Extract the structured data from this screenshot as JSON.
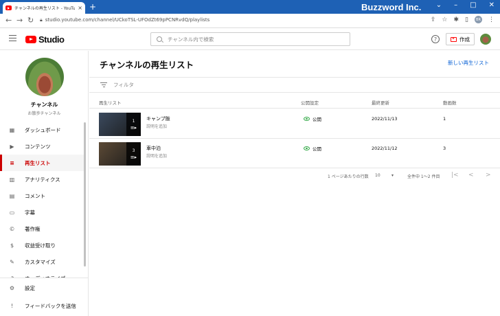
{
  "browser": {
    "tab_title": "チャンネルの再生リスト - YouTube Stu",
    "url": "studio.youtube.com/channel/UCkoTSL-UFOdZt69pPCNRvdQ/playlists",
    "brand": "Buzzword Inc.",
    "profile_initials": "BR"
  },
  "header": {
    "logo_text": "Studio",
    "search_placeholder": "チャンネル内で検索",
    "create_label": "作成"
  },
  "channel": {
    "name": "チャンネル",
    "subtitle": "お散歩チャンネル"
  },
  "sidebar": {
    "items": [
      {
        "label": "ダッシュボード",
        "icon": "dashboard-icon"
      },
      {
        "label": "コンテンツ",
        "icon": "content-icon"
      },
      {
        "label": "再生リスト",
        "icon": "playlist-icon",
        "active": true
      },
      {
        "label": "アナリティクス",
        "icon": "analytics-icon"
      },
      {
        "label": "コメント",
        "icon": "comment-icon"
      },
      {
        "label": "字幕",
        "icon": "subtitles-icon"
      },
      {
        "label": "著作権",
        "icon": "copyright-icon"
      },
      {
        "label": "収益受け取り",
        "icon": "monetization-icon"
      },
      {
        "label": "カスタマイズ",
        "icon": "customize-icon"
      },
      {
        "label": "オーディオライブ",
        "icon": "audio-library-icon"
      }
    ],
    "bottom": [
      {
        "label": "設定",
        "icon": "settings-icon"
      },
      {
        "label": "フィードバックを送信",
        "icon": "feedback-icon"
      }
    ]
  },
  "main": {
    "title": "チャンネルの再生リスト",
    "new_playlist": "新しい再生リスト",
    "filter_label": "フィルタ",
    "columns": {
      "playlist": "再生リスト",
      "visibility": "公開設定",
      "updated": "最終更新",
      "count": "動画数"
    },
    "rows": [
      {
        "title": "キャンプ飯",
        "desc": "説明を追加",
        "visibility": "公開",
        "updated": "2022/11/13",
        "count": "1",
        "thumb_count": "1",
        "thumb_color": "#3b4a5e"
      },
      {
        "title": "車中泊",
        "desc": "説明を追加",
        "visibility": "公開",
        "updated": "2022/11/12",
        "count": "3",
        "thumb_count": "3",
        "thumb_color": "#5c4a36"
      }
    ],
    "pager": {
      "rows_per_page_label": "1 ページあたりの行数",
      "rows_per_page": "10",
      "range": "全件中 1～2 件目"
    }
  }
}
